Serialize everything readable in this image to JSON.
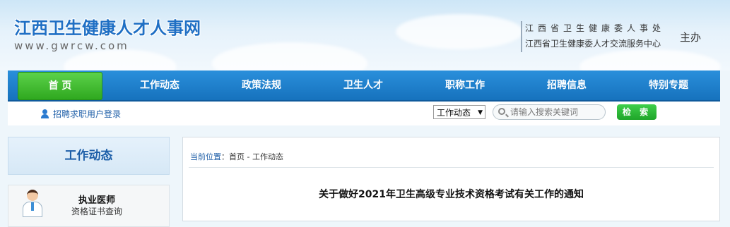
{
  "header": {
    "site_title": "江西卫生健康人才人事网",
    "site_url": "www.gwrcw.com",
    "sponsor_line1": "江西省卫生健康委人事处",
    "sponsor_line2": "江西省卫生健康委人才交流服务中心",
    "sponsor_host": "主办"
  },
  "nav": {
    "items": [
      {
        "label": "首 页",
        "active": true
      },
      {
        "label": "工作动态"
      },
      {
        "label": "政策法规"
      },
      {
        "label": "卫生人才"
      },
      {
        "label": "职称工作"
      },
      {
        "label": "招聘信息"
      },
      {
        "label": "特别专题"
      }
    ]
  },
  "toolbar": {
    "login_label": "招聘求职用户登录",
    "category_selected": "工作动态",
    "search_placeholder": "请输入搜索关键词",
    "search_button": "检 索"
  },
  "sidebar": {
    "heading": "工作动态",
    "card_title": "执业医师",
    "card_subtitle": "资格证书查询"
  },
  "main": {
    "breadcrumb_label": "当前位置",
    "breadcrumb_path": "：首页 - 工作动态",
    "article_title": "关于做好2021年卫生高级专业技术资格考试有关工作的通知"
  },
  "colors": {
    "nav_blue": "#1f80cc",
    "nav_active_green": "#3fbf35",
    "title_blue": "#1f6fc4",
    "search_green": "#2bb836"
  }
}
